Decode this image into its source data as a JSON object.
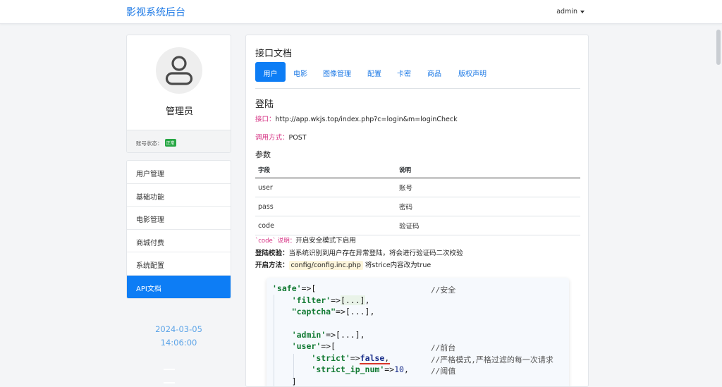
{
  "header": {
    "brand": "影视系统后台",
    "user": "admin"
  },
  "profile": {
    "name": "管理员",
    "status_label": "账号状态：",
    "status_badge": "正常"
  },
  "menu": {
    "items": [
      "用户管理",
      "基础功能",
      "电影管理",
      "商城付费",
      "系统配置",
      "API文档"
    ],
    "active": "API文档"
  },
  "clock": {
    "date": "2024-03-05",
    "time": "14:06:00"
  },
  "doc": {
    "title": "接口文档",
    "tabs": [
      "用户",
      "电影",
      "图像管理",
      "配置",
      "卡密",
      "商品",
      "版权声明"
    ],
    "section": "登陆",
    "api_label": "接口：",
    "api_url": "http://app.wkjs.top/index.php?c=login&m=loginCheck",
    "method_label": "调用方式：",
    "method": "POST",
    "params_title": "参数",
    "table": {
      "headers": [
        "字段",
        "说明"
      ],
      "rows": [
        [
          "user",
          "账号"
        ],
        [
          "pass",
          "密码"
        ],
        [
          "code",
          "验证码"
        ]
      ]
    },
    "code_note_key": "`code` 说明：",
    "code_note": "开启安全模式下启用",
    "check_label": "登陆校验：",
    "check_text": "当系统识别到用户存在异常登陆，将会进行验证码二次校验",
    "enable_label": "开启方法：",
    "enable_file": "config/config.inc.php",
    "enable_text": " 将strice内容改为true"
  },
  "code": {
    "comment_safe": "//安全",
    "comment_front": "//前台",
    "comment_strict": "//严格模式,严格过滤的每一次请求",
    "comment_threshold": "//阈值",
    "str_safe": "'safe'",
    "str_filter": "'filter'",
    "str_captcha": "\"captcha\"",
    "str_admin": "'admin'",
    "str_user": "'user'",
    "str_strict": "'strict'",
    "str_strict_ip": "'strict_ip_num'",
    "val_false": "false",
    "val_num": "10"
  }
}
